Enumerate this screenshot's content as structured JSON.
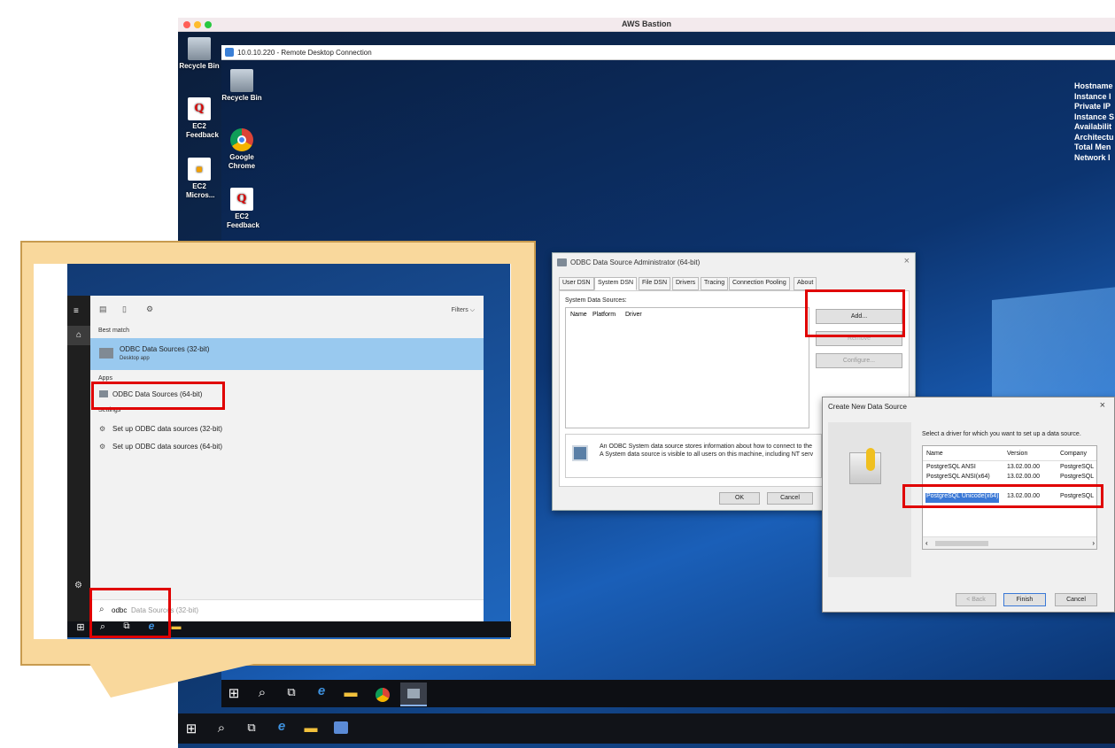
{
  "mac_window": {
    "title": "AWS Bastion"
  },
  "outer_desktop": {
    "icons": [
      {
        "label": "Recycle Bin"
      },
      {
        "label": "EC2 Feedback"
      },
      {
        "label": "EC2 Micros..."
      }
    ]
  },
  "rdp": {
    "title": "10.0.10.220 - Remote Desktop Connection"
  },
  "inner_desktop": {
    "icons": [
      {
        "label": "Recycle Bin"
      },
      {
        "label": "Google Chrome"
      },
      {
        "label": "EC2 Feedback"
      }
    ],
    "sysinfo": [
      "Hostname",
      "Instance I",
      "Private IP",
      "Instance S",
      "Availabilit",
      "Architectu",
      "Total Men",
      "Network I"
    ]
  },
  "odbc_admin": {
    "title": "ODBC Data Source Administrator (64-bit)",
    "tabs": [
      "User DSN",
      "System DSN",
      "File DSN",
      "Drivers",
      "Tracing",
      "Connection Pooling",
      "About"
    ],
    "section": "System Data Sources:",
    "columns": [
      "Name",
      "Platform",
      "Driver"
    ],
    "buttons": {
      "add": "Add...",
      "remove": "Remove",
      "configure": "Configure..."
    },
    "info_line1": "An ODBC System data source stores information about how to connect to the",
    "info_line2": "A System data source is visible to all users on this machine, including NT serv",
    "ok": "OK",
    "cancel": "Cancel"
  },
  "create_ds": {
    "title": "Create New Data Source",
    "prompt": "Select a driver for which you want to set up a data source.",
    "columns": [
      "Name",
      "Version",
      "Company"
    ],
    "drivers": [
      {
        "name": "PostgreSQL ANSI",
        "version": "13.02.00.00",
        "company": "PostgreSQL"
      },
      {
        "name": "PostgreSQL ANSI(x64)",
        "version": "13.02.00.00",
        "company": "PostgreSQL"
      },
      {
        "name": "PostgreSQL Unicode(x64)",
        "version": "13.02.00.00",
        "company": "PostgreSQL"
      }
    ],
    "back": "< Back",
    "finish": "Finish",
    "cancel": "Cancel"
  },
  "start_search": {
    "filters": "Filters",
    "best_match_label": "Best match",
    "best_match": {
      "title": "ODBC Data Sources (32-bit)",
      "subtitle": "Desktop app"
    },
    "apps_label": "Apps",
    "apps": [
      {
        "title": "ODBC Data Sources (64-bit)"
      }
    ],
    "settings_label": "Settings",
    "settings": [
      {
        "title": "Set up ODBC data sources (32-bit)"
      },
      {
        "title": "Set up ODBC data sources (64-bit)"
      }
    ],
    "query": "odbc",
    "query_suggestion": "Data Sources (32-bit)"
  },
  "colors": {
    "highlight_red": "#e00000",
    "callout": "#f9d89c",
    "selection": "#99c9ef"
  }
}
